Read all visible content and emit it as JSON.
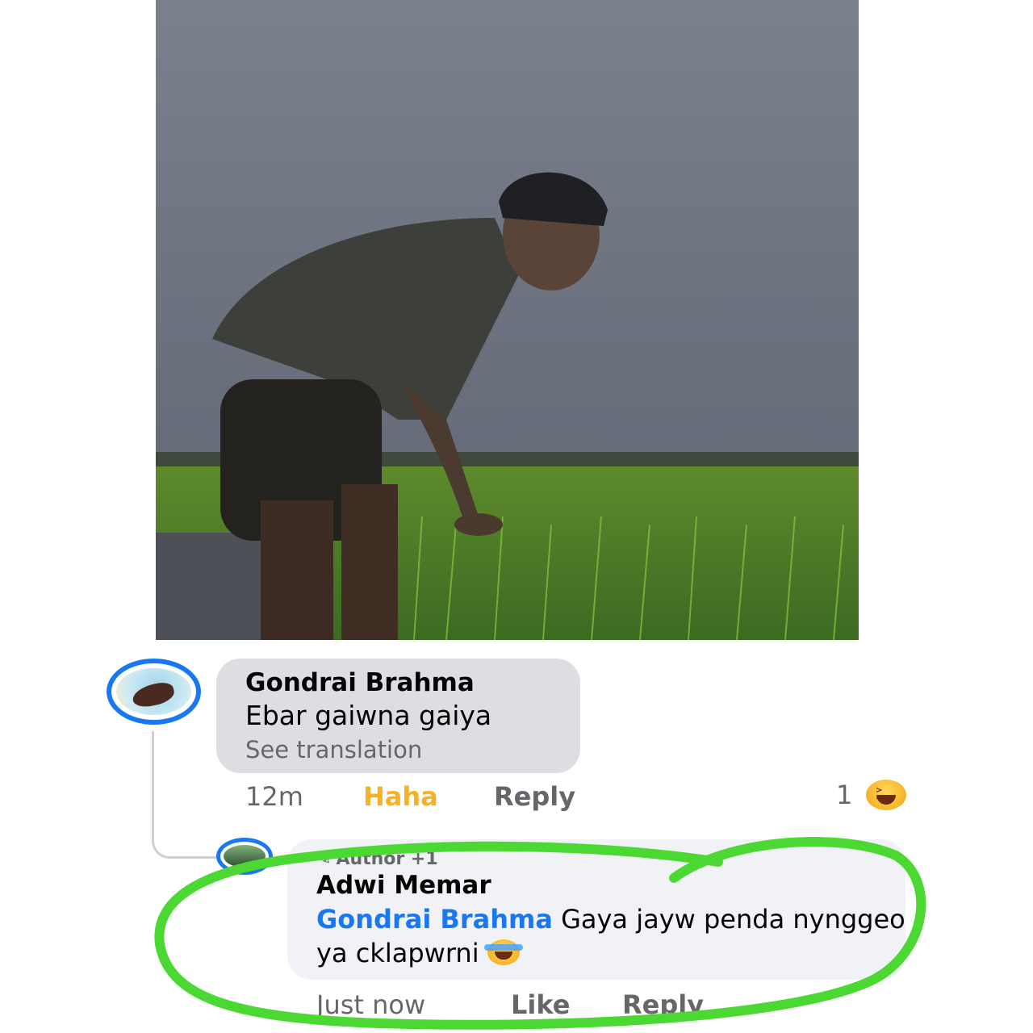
{
  "post": {
    "photo_icon": "photo-image"
  },
  "comment": {
    "author": "Gondrai Brahma",
    "text": "Ebar gaiwna gaiya",
    "see_translation": "See translation",
    "time": "12m",
    "reaction_label": "Haha",
    "reply_label": "Reply",
    "reaction_count": "1",
    "reaction_icon": "laughing-emoji-icon"
  },
  "reply": {
    "badge": "Author +1",
    "author": "Adwi Memar",
    "mention": "Gondrai Brahma",
    "text": " Gaya jayw penda nynggeo ya cklapwrni",
    "emoji_icon": "rolling-laughing-emoji-icon",
    "time": "Just now",
    "like_label": "Like",
    "reply_label": "Reply"
  },
  "colors": {
    "highlight_stroke": "#4cd832",
    "link_blue": "#1877f2",
    "haha_yellow": "#f7b125"
  }
}
